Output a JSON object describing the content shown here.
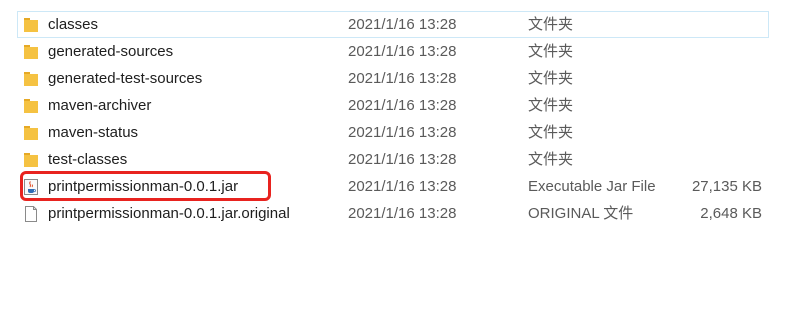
{
  "colors": {
    "folder": "#f5c242",
    "highlight": "#e8231f",
    "row_outline": "#cde8f7"
  },
  "files": [
    {
      "name": "classes",
      "date": "2021/1/16 13:28",
      "type": "文件夹",
      "size": "",
      "icon": "folder-icon"
    },
    {
      "name": "generated-sources",
      "date": "2021/1/16 13:28",
      "type": "文件夹",
      "size": "",
      "icon": "folder-icon"
    },
    {
      "name": "generated-test-sources",
      "date": "2021/1/16 13:28",
      "type": "文件夹",
      "size": "",
      "icon": "folder-icon"
    },
    {
      "name": "maven-archiver",
      "date": "2021/1/16 13:28",
      "type": "文件夹",
      "size": "",
      "icon": "folder-icon"
    },
    {
      "name": "maven-status",
      "date": "2021/1/16 13:28",
      "type": "文件夹",
      "size": "",
      "icon": "folder-icon"
    },
    {
      "name": "test-classes",
      "date": "2021/1/16 13:28",
      "type": "文件夹",
      "size": "",
      "icon": "folder-icon"
    },
    {
      "name": "printpermissionman-0.0.1.jar",
      "date": "2021/1/16 13:28",
      "type": "Executable Jar File",
      "size": "27,135 KB",
      "icon": "java-jar-icon"
    },
    {
      "name": "printpermissionman-0.0.1.jar.original",
      "date": "2021/1/16 13:28",
      "type": "ORIGINAL 文件",
      "size": "2,648 KB",
      "icon": "blank-file-icon"
    }
  ]
}
